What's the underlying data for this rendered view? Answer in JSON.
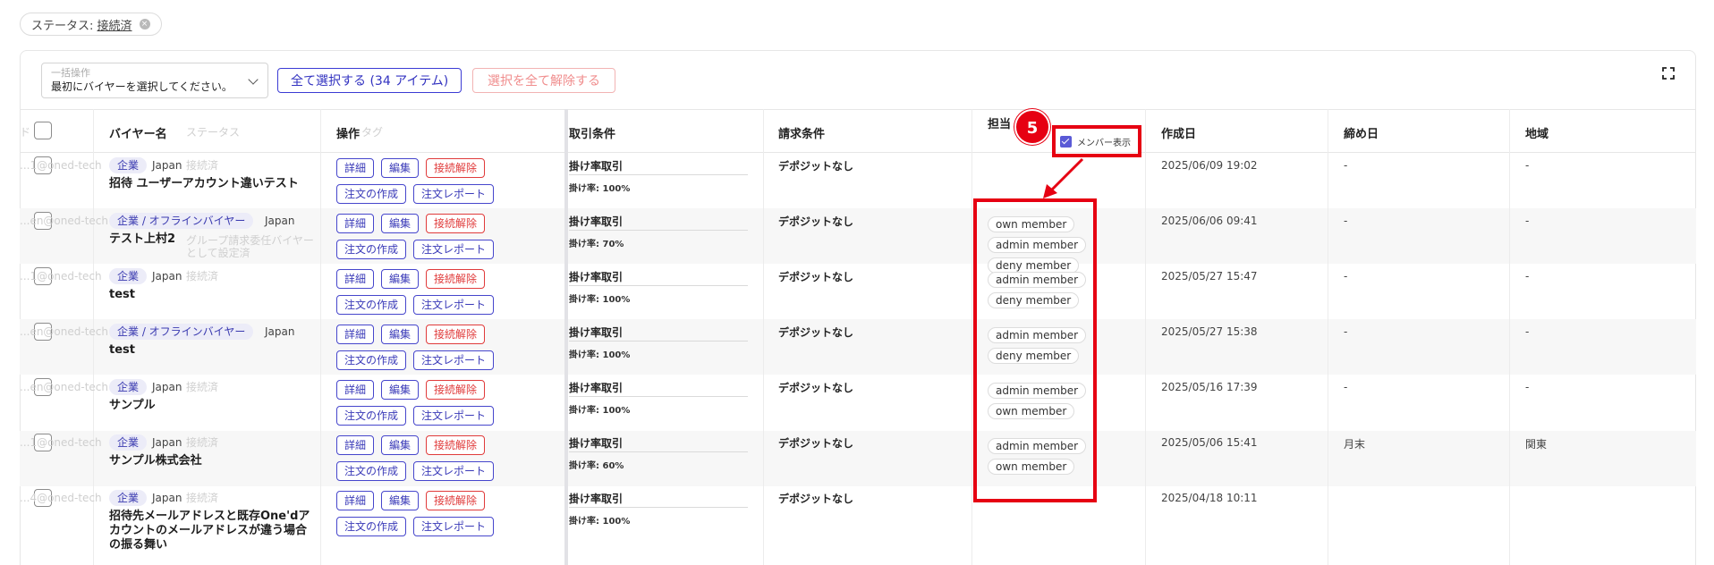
{
  "filter": {
    "label": "ステータス: ",
    "value": "接続済",
    "close": "×"
  },
  "toolbar": {
    "bulk_label": "一括操作",
    "bulk_placeholder": "最初にバイヤーを選択してください。",
    "select_all": "全て選択する (34 アイテム)",
    "deselect_all": "選択を全て解除する"
  },
  "headers": {
    "buyer_name": "バイヤー名",
    "status": "ステータス",
    "operation": "操作",
    "tag": "タグ",
    "trade_terms": "取引条件",
    "billing_terms": "請求条件",
    "assignee": "担当",
    "member_toggle": "メンバー表示",
    "created": "作成日",
    "closing": "締め日",
    "region": "地域",
    "ghost_left": "ド"
  },
  "annotation": {
    "badge": "5"
  },
  "buttons": {
    "detail": "詳細",
    "edit": "編集",
    "disconnect": "接続解除",
    "create_order": "注文の作成",
    "order_report": "注文レポート"
  },
  "rows": [
    {
      "tags": [
        "企業"
      ],
      "country": "Japan",
      "name": "招待 ユーザーアカウント違いテスト",
      "ghost_email": "...1@oned-tech",
      "ghost_status": "接続済",
      "terms": "掛け率取引",
      "rate": "掛け率: 100%",
      "billing": "デポジットなし",
      "members": [],
      "created": "2025/06/09 19:02",
      "closing": "-",
      "region": "-"
    },
    {
      "tags": [
        "企業 / オフラインバイヤー"
      ],
      "country": "Japan",
      "name": "テスト上村2",
      "ghost_email": "...en@oned-tech",
      "ghost_status": "グループ請求委任バイヤーとして設定済",
      "terms": "掛け率取引",
      "rate": "掛け率: 70%",
      "billing": "デポジットなし",
      "members": [
        "own member",
        "admin member",
        "deny member"
      ],
      "created": "2025/06/06 09:41",
      "closing": "-",
      "region": "-"
    },
    {
      "tags": [
        "企業"
      ],
      "country": "Japan",
      "name": "test",
      "ghost_email": "...1@oned-tech",
      "ghost_status": "接続済",
      "terms": "掛け率取引",
      "rate": "掛け率: 100%",
      "billing": "デポジットなし",
      "members": [
        "admin member",
        "deny member"
      ],
      "created": "2025/05/27 15:47",
      "closing": "-",
      "region": "-"
    },
    {
      "tags": [
        "企業 / オフラインバイヤー"
      ],
      "country": "Japan",
      "name": "test",
      "ghost_email": "...en@oned-tech",
      "ghost_status": "",
      "terms": "掛け率取引",
      "rate": "掛け率: 100%",
      "billing": "デポジットなし",
      "members": [
        "admin member",
        "deny member"
      ],
      "created": "2025/05/27 15:38",
      "closing": "-",
      "region": "-"
    },
    {
      "tags": [
        "企業"
      ],
      "country": "Japan",
      "name": "サンプル",
      "ghost_email": "...en@oned-tech",
      "ghost_status": "接続済",
      "terms": "掛け率取引",
      "rate": "掛け率: 100%",
      "billing": "デポジットなし",
      "members": [
        "admin member",
        "own member"
      ],
      "created": "2025/05/16 17:39",
      "closing": "-",
      "region": "-"
    },
    {
      "tags": [
        "企業"
      ],
      "country": "Japan",
      "name": "サンプル株式会社",
      "ghost_email": "...1@oned-tech",
      "ghost_status": "接続済",
      "terms": "掛け率取引",
      "rate": "掛け率: 60%",
      "billing": "デポジットなし",
      "members": [
        "admin member",
        "own member"
      ],
      "created": "2025/05/06 15:41",
      "closing": "月末",
      "region": "関東"
    },
    {
      "tags": [
        "企業"
      ],
      "country": "Japan",
      "name": "招待先メールアドレスと既存One'dアカウントのメールアドレスが違う場合の振る舞い",
      "ghost_email": "...4@oned-tech",
      "ghost_status": "接続済",
      "terms": "掛け率取引",
      "rate": "掛け率: 100%",
      "billing": "デポジットなし",
      "members": [],
      "created": "2025/04/18 10:11",
      "closing": "",
      "region": ""
    }
  ]
}
